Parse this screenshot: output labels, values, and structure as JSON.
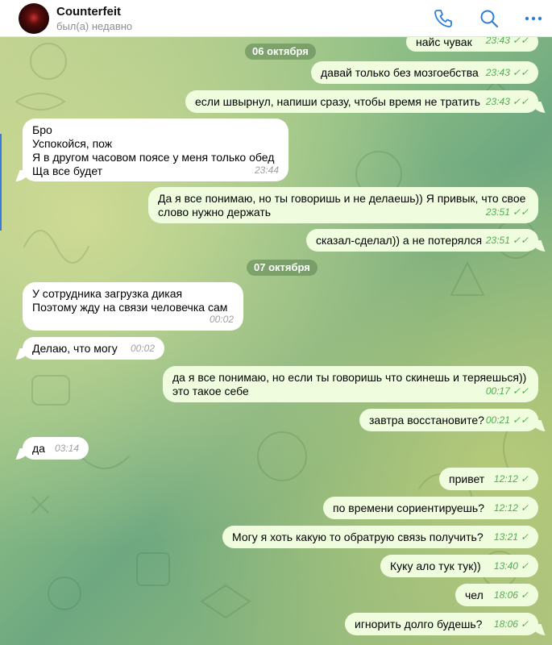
{
  "header": {
    "title": "Counterfeit",
    "status": "был(а) недавно",
    "icons": [
      "phone-icon",
      "search-icon",
      "more-icon"
    ]
  },
  "dates": [
    "06 октября",
    "07 октября"
  ],
  "messages": [
    {
      "dir": "out",
      "text": "найс чувак",
      "time": "23:43",
      "read": true
    },
    {
      "dir": "out",
      "text": "давай только без мозгоебства",
      "time": "23:43",
      "read": true
    },
    {
      "dir": "out",
      "text": "если швырнул, напиши сразу, чтобы время не тратить",
      "time": "23:43",
      "read": true
    },
    {
      "dir": "in",
      "text": "Бро\nУспокойся, пож\nЯ в другом часовом поясе у меня только обед\nЩа все будет",
      "time": "23:44"
    },
    {
      "dir": "out",
      "text": "Да я все понимаю, но ты говоришь и не делаешь)) Я привык, что свое\nслово нужно держать",
      "time": "23:51",
      "read": true
    },
    {
      "dir": "out",
      "text": "сказал-сделал)) а не потерялся",
      "time": "23:51",
      "read": true
    },
    {
      "dir": "in",
      "text": "У сотрудника загрузка дикая\nПоэтому жду на связи человечка сам",
      "time": "00:02"
    },
    {
      "dir": "in",
      "text": "Делаю, что могу",
      "time": "00:02"
    },
    {
      "dir": "out",
      "text": "да я все понимаю, но если ты говоришь что скинешь и теряешься))\nэто такое себе",
      "time": "00:17",
      "read": true
    },
    {
      "dir": "out",
      "text": "завтра восстановите?",
      "time": "00:21",
      "read": true
    },
    {
      "dir": "in",
      "text": "да",
      "time": "03:14"
    },
    {
      "dir": "out",
      "text": "привет",
      "time": "12:12",
      "read": false
    },
    {
      "dir": "out",
      "text": "по времени сориентируешь?",
      "time": "12:12",
      "read": false
    },
    {
      "dir": "out",
      "text": "Могу я хоть какую то обратрую связь получить?",
      "time": "13:21",
      "read": false
    },
    {
      "dir": "out",
      "text": "Куку ало тук тук))",
      "time": "13:40",
      "read": false
    },
    {
      "dir": "out",
      "text": "чел",
      "time": "18:06",
      "read": false
    },
    {
      "dir": "out",
      "text": "игнорить долго будешь?",
      "time": "18:06",
      "read": false
    }
  ],
  "colors": {
    "accent": "#2f7fd8",
    "incoming_bubble": "#ffffff",
    "outgoing_bubble": "#effdde",
    "outgoing_meta": "#4fae4e"
  }
}
